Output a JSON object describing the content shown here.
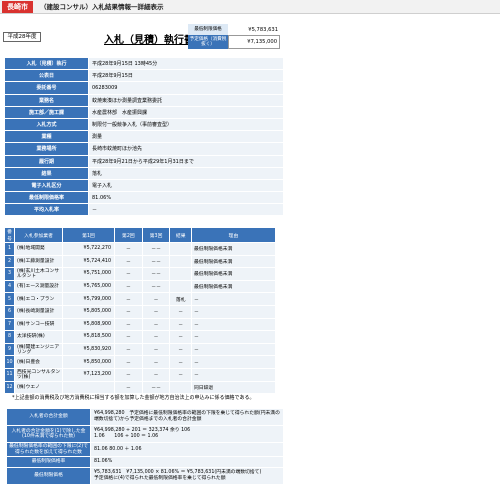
{
  "header": {
    "city": "長崎市",
    "title": "（建設コンサル）入札結果情報一詳細表示"
  },
  "fiscal_year": "平成28年度",
  "heading": "入札（見積）執行書",
  "prices": {
    "min_limit_label": "最低制限価格",
    "min_limit_value": "¥5,783,631",
    "estimated_label": "予定価格（消費税抜く）",
    "estimated_value": "¥7,135,000"
  },
  "info": [
    {
      "label": "入札（見積）執行",
      "value": "平成28年9月15日 13時45分"
    },
    {
      "label": "公表日",
      "value": "平成28年9月15日"
    },
    {
      "label": "委託番号",
      "value": "06283009"
    },
    {
      "label": "業務名",
      "value": "蚊焼東湊ほか測量調査業務委託"
    },
    {
      "label": "施工部／施工課",
      "value": "水産農林部　水産振興課"
    },
    {
      "label": "入札方式",
      "value": "制限付一般競争入札（事前審査型）"
    },
    {
      "label": "業種",
      "value": "測量"
    },
    {
      "label": "業務場所",
      "value": "長崎市蚊焼町ほか池先"
    },
    {
      "label": "履行期",
      "value": "平成28年9月21日から平成29年1月31日まで"
    },
    {
      "label": "結果",
      "value": "落札"
    },
    {
      "label": "電子入札区分",
      "value": "電子入札"
    },
    {
      "label": "最低制限価格率",
      "value": "81.06%"
    },
    {
      "label": "平均入札率",
      "value": "－"
    }
  ],
  "bid_table": {
    "headers": [
      "番号",
      "入札参加業者",
      "第1回",
      "第2回",
      "第3回",
      "結果",
      "理由"
    ],
    "rows": [
      {
        "no": "1",
        "name": "(株)地域開発",
        "r1": "¥5,722,270",
        "r2": "－",
        "r3": "－－",
        "result": "",
        "reason": "最低制限価格未満"
      },
      {
        "no": "2",
        "name": "(株)工藤測量設計",
        "r1": "¥5,724,410",
        "r2": "－",
        "r3": "－－",
        "result": "",
        "reason": "最低制限価格未満"
      },
      {
        "no": "3",
        "name": "(株)玄川土木コンサルタント",
        "r1": "¥5,751,000",
        "r2": "－",
        "r3": "－－",
        "result": "",
        "reason": "最低制限価格未満"
      },
      {
        "no": "4",
        "name": "(有)エース測量設計",
        "r1": "¥5,765,000",
        "r2": "－",
        "r3": "－－",
        "result": "",
        "reason": "最低制限価格未満"
      },
      {
        "no": "5",
        "name": "(株)エコ・プラン",
        "r1": "¥5,799,000",
        "r2": "－",
        "r3": "－",
        "result": "落札",
        "reason": "－"
      },
      {
        "no": "6",
        "name": "(株)長崎測量設計",
        "r1": "¥5,805,000",
        "r2": "－",
        "r3": "－",
        "result": "－",
        "reason": "－"
      },
      {
        "no": "7",
        "name": "(株)サンコー技研",
        "r1": "¥5,808,900",
        "r2": "－",
        "r3": "－",
        "result": "－",
        "reason": "－"
      },
      {
        "no": "8",
        "name": "太洋技研(株)",
        "r1": "¥5,818,500",
        "r2": "－",
        "r3": "－",
        "result": "－",
        "reason": "－"
      },
      {
        "no": "9",
        "name": "(株)開建エンジニアリング",
        "r1": "¥5,830,920",
        "r2": "－",
        "r3": "－",
        "result": "－",
        "reason": "－"
      },
      {
        "no": "10",
        "name": "(株)日豊会",
        "r1": "¥5,850,000",
        "r2": "－",
        "r3": "－",
        "result": "－",
        "reason": "－"
      },
      {
        "no": "11",
        "name": "西技光コンサルタンツ(株)",
        "r1": "¥7,123,200",
        "r2": "－",
        "r3": "－",
        "result": "－",
        "reason": "－"
      },
      {
        "no": "12",
        "name": "(株)ウエノ",
        "r1": "",
        "r2": "－",
        "r3": "－－",
        "result": "",
        "reason": "同日辞退"
      }
    ]
  },
  "note": "*上記金額の消費税及び地方消費税に相当する額を加算した金額が地方自治法上の申込みに係る価格である。",
  "calc": [
    {
      "label": "入札者の合計金額",
      "lines": [
        "¥64,998,280　予定価格に最低制限価格率の範囲の下限を乗じて得られた額(円未満の端数切捨て)から予定価格までの入札者の合計金額"
      ]
    },
    {
      "label": "入札者の合計金額を(1)で除した金(10件未満で得られた数)",
      "lines": [
        "¥64,998,280 ÷ 201 ＝ 323,374 余り 106",
        "1.06　　106 ÷ 100 ＝ 1.06"
      ]
    },
    {
      "label": "最低制限価格率の範囲の下限に(2)で得られた数を加えて得られた数",
      "lines": [
        "81.06 80.00 ＋ 1.06"
      ]
    },
    {
      "label": "最低制限価格率",
      "lines": [
        "81.06%"
      ]
    },
    {
      "label": "最低制限価格",
      "lines": [
        "¥5,783,631　¥7,135,000 × 81.06% ＝ ¥5,783,631(円未満の端数切捨て)",
        "予定価格に(4)で得られた最低制限価格率を乗じて得られた額"
      ]
    }
  ]
}
